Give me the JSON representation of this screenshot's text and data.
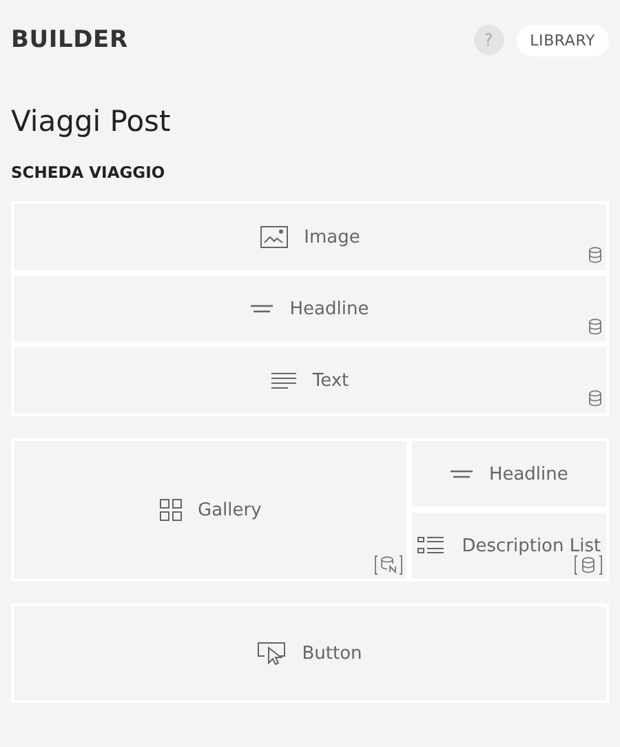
{
  "header": {
    "title": "BUILDER",
    "help": "?",
    "library": "LIBRARY"
  },
  "page_title": "Viaggi Post",
  "section_title": "SCHEDA VIAGGIO",
  "groups": [
    {
      "columns": [
        [
          {
            "kind": "image",
            "label": "Image",
            "badge": {
              "kind": "database",
              "bracketed": false
            }
          },
          {
            "kind": "headline",
            "label": "Headline",
            "badge": {
              "kind": "database",
              "bracketed": false
            }
          },
          {
            "kind": "text",
            "label": "Text",
            "badge": {
              "kind": "database",
              "bracketed": false
            }
          }
        ]
      ]
    },
    {
      "columns": [
        [
          {
            "kind": "gallery",
            "label": "Gallery",
            "badge": {
              "kind": "locale",
              "bracketed": true
            }
          }
        ],
        [
          {
            "kind": "headline",
            "label": "Headline"
          },
          {
            "kind": "description_list",
            "label": "Description List",
            "badge": {
              "kind": "database",
              "bracketed": true
            }
          }
        ]
      ]
    },
    {
      "columns": [
        [
          {
            "kind": "button",
            "label": "Button"
          }
        ]
      ]
    }
  ]
}
